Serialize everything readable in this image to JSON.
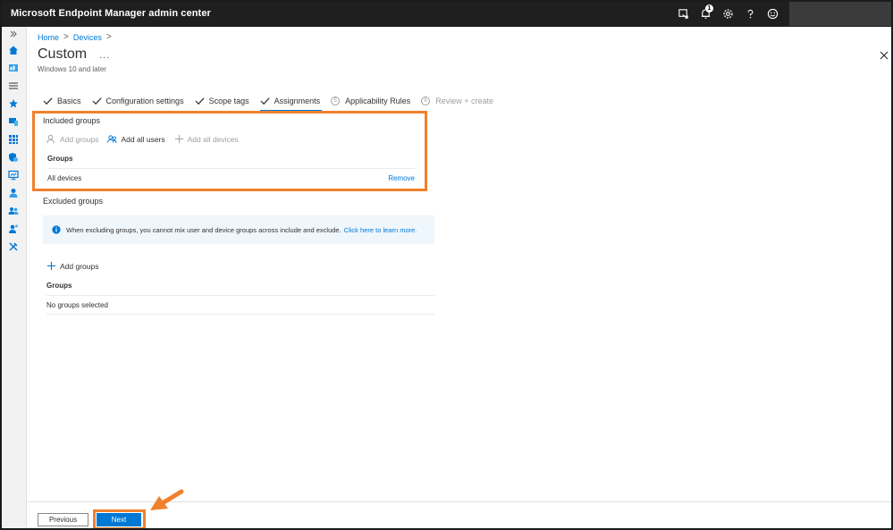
{
  "app": {
    "title": "Microsoft Endpoint Manager admin center",
    "notification_count": "1"
  },
  "topbar_icons": [
    "remote-icon",
    "bell-icon",
    "gear-icon",
    "help-icon",
    "smiley-icon"
  ],
  "rail_icons": [
    "expand-icon",
    "home-icon",
    "dashboard-icon",
    "all-services-icon",
    "favorites-icon",
    "devices-icon",
    "apps-icon",
    "endpoint-security-icon",
    "reports-icon",
    "users-icon",
    "groups-icon",
    "tenant-admin-icon",
    "troubleshooting-icon"
  ],
  "breadcrumb": {
    "home": "Home",
    "devices": "Devices",
    "sep": ">"
  },
  "page": {
    "title": "Custom",
    "more": "...",
    "subtitle": "Windows 10 and later"
  },
  "tabs": [
    {
      "label": "Basics",
      "state": "done"
    },
    {
      "label": "Configuration settings",
      "state": "done"
    },
    {
      "label": "Scope tags",
      "state": "done"
    },
    {
      "label": "Assignments",
      "state": "active"
    },
    {
      "label": "Applicability Rules",
      "state": "step",
      "num": "5"
    },
    {
      "label": "Review + create",
      "state": "disabled",
      "num": "6"
    }
  ],
  "included": {
    "title": "Included groups",
    "add_groups": "Add groups",
    "add_all_users": "Add all users",
    "add_all_devices": "Add all devices",
    "column": "Groups",
    "row": "All devices",
    "remove": "Remove"
  },
  "excluded": {
    "title": "Excluded groups",
    "info": "When excluding groups, you cannot mix user and device groups across include and exclude.",
    "info_link": "Click here to learn more.",
    "add_groups": "Add groups",
    "column": "Groups",
    "row": "No groups selected"
  },
  "footer": {
    "previous": "Previous",
    "next": "Next"
  },
  "colors": {
    "accent": "#0078d4",
    "highlight": "#f0812d",
    "topbar": "#1f1f1f"
  }
}
